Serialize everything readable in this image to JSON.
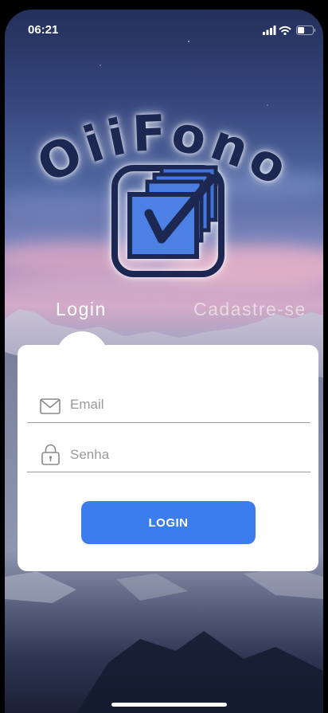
{
  "status_bar": {
    "time": "06:21",
    "signal_bars": 4,
    "battery_level": 0.45,
    "icons": [
      "signal-icon",
      "wifi-icon",
      "battery-icon"
    ]
  },
  "logo": {
    "text": "OiiFono",
    "emblem_icon": "checked-documents-icon"
  },
  "tabs": [
    {
      "label": "Login",
      "active": true
    },
    {
      "label": "Cadastre-se",
      "active": false
    }
  ],
  "form": {
    "email": {
      "placeholder": "Email",
      "value": "",
      "icon": "envelope-icon"
    },
    "password": {
      "placeholder": "Senha",
      "value": "",
      "icon": "lock-icon"
    },
    "submit_label": "LOGIN"
  },
  "colors": {
    "accent": "#3b7ded",
    "logo_navy": "#1d2852",
    "card_background": "#ffffff",
    "placeholder": "#9b9b9b",
    "inactive_tab": "rgba(255,255,255,0.55)"
  }
}
